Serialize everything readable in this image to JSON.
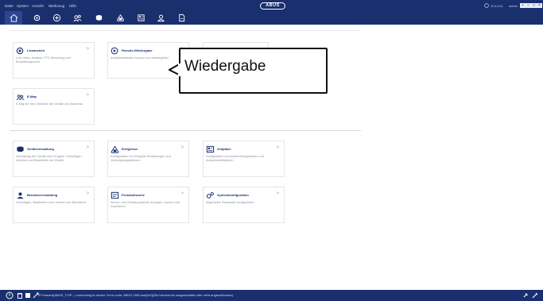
{
  "menu": [
    "Datei",
    "System",
    "Ansicht",
    "Werkzeug",
    "Hilfe"
  ],
  "logo": "ABUS",
  "status_right": {
    "time": "10:14:41",
    "user": "admin"
  },
  "window_buttons": [
    "▪",
    "–",
    "□",
    "×"
  ],
  "nav_icons": [
    "home-icon",
    "gear-icon",
    "plus-circle-icon",
    "camera-group-icon",
    "database-icon",
    "user-lock-icon",
    "grid-icon",
    "user-icon",
    "document-icon"
  ],
  "tiles": {
    "live": {
      "title": "Liveansicht",
      "arrow": ">",
      "desc": "Live-Video, Analyse, PTZ-Steuerung und Einstellungsmenü"
    },
    "playback": {
      "title": "Remote-Wiedergabe",
      "arrow": ">",
      "desc": "Aufnahmedateien suchen und wiedergeben"
    },
    "emap": {
      "title": "E-Map",
      "arrow": ">",
      "desc": "E-Map für den Überblick der Geräte und Kameras"
    },
    "device": {
      "title": "Geräteverwaltung",
      "arrow": ">",
      "desc": "Verwaltung der Geräte und Gruppen: Hinzufügen, Löschen und Bearbeiten der Geräte"
    },
    "event": {
      "title": "Ereignisse",
      "arrow": ">",
      "desc": "Konfiguration von Ereignis-Einstellungen und Verknüpfungsaktionen"
    },
    "schedule": {
      "title": "Zeitpläne",
      "arrow": ">",
      "desc": "Konfiguration von Aufzeichnungszeiten und Aufnahmezeitplänen"
    },
    "user": {
      "title": "Benutzerverwaltung",
      "arrow": ">",
      "desc": "Hinzufügen, Bearbeiten und Löschen von Benutzern"
    },
    "log": {
      "title": "Protokollsuche",
      "arrow": ">",
      "desc": "Server- und Geräteprotokolle anzeigen, suchen und exportieren"
    },
    "system": {
      "title": "Systemkonfiguration",
      "arrow": ">",
      "desc": "Allgemeine Parameter konfigurieren"
    }
  },
  "callout": {
    "text": "Wiedergabe"
  },
  "statusbar": {
    "text": "IP-Kamera(ABUS_TVIP...) connecting to device. Error code: ABUS CMS.ww(0x0)(Die Kamera ist ausgeschaltet oder nicht angeschlossen)"
  },
  "colors": {
    "header": "#1a2f6e",
    "accent": "#2b4690",
    "tile_title": "#1a2f6e",
    "desc": "#8a8f99"
  }
}
